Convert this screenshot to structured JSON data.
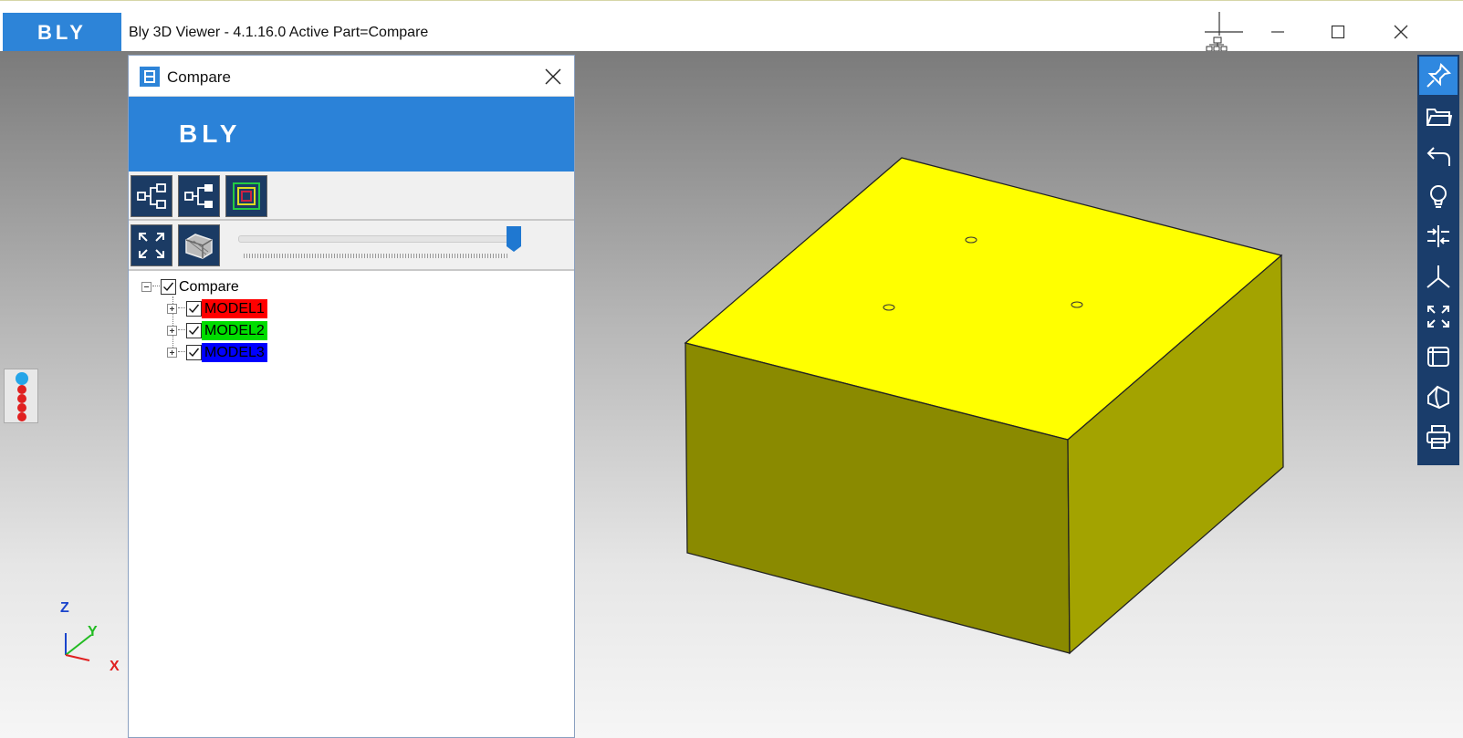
{
  "titlebar": {
    "brand": "BLY",
    "title": "Bly 3D Viewer - 4.1.16.0 Active Part=Compare"
  },
  "panel": {
    "title": "Compare",
    "banner": "BLY"
  },
  "tree": {
    "root": "Compare",
    "items": [
      {
        "label": "MODEL1",
        "color": "#ff0000"
      },
      {
        "label": "MODEL2",
        "color": "#00dd00"
      },
      {
        "label": "MODEL3",
        "color": "#0000ff"
      }
    ]
  },
  "slider": {
    "value": 1.0
  },
  "axes": {
    "z": "Z",
    "y": "Y",
    "x": "X"
  },
  "colors": {
    "accent": "#2d84d8",
    "toolbar": "#1a3d6b",
    "toolbar_active": "#2f88e0",
    "model_top": "#ffff00",
    "model_front": "#8a8a00",
    "model_side": "#a3a300"
  },
  "icons": {
    "right_toolbar": [
      "pin-icon",
      "open-folder-icon",
      "undo-icon",
      "bulb-icon",
      "compare-icon",
      "axis-icon",
      "fit-icon",
      "view-cube-icon",
      "shape-icon",
      "print-icon"
    ]
  }
}
